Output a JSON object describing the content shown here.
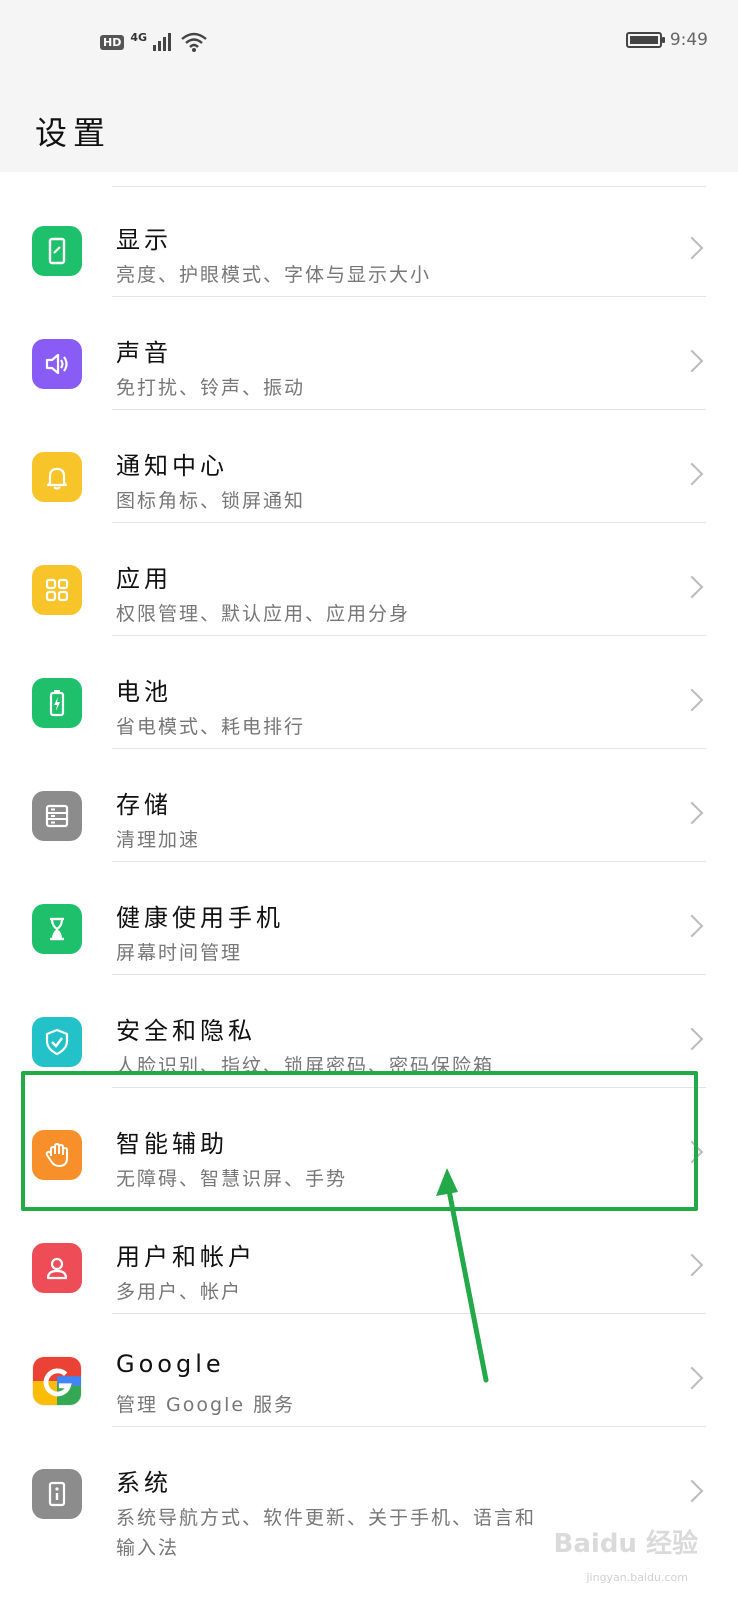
{
  "status_bar": {
    "hd": "HD",
    "network": "4G",
    "time": "9:49"
  },
  "header": {
    "title": "设置"
  },
  "items": [
    {
      "title": "显示",
      "subtitle": "亮度、护眼模式、字体与显示大小",
      "icon": "phone-display-icon",
      "color": "#1ec06b"
    },
    {
      "title": "声音",
      "subtitle": "免打扰、铃声、振动",
      "icon": "speaker-icon",
      "color": "#8a5cf6"
    },
    {
      "title": "通知中心",
      "subtitle": "图标角标、锁屏通知",
      "icon": "bell-icon",
      "color": "#f7c42a"
    },
    {
      "title": "应用",
      "subtitle": "权限管理、默认应用、应用分身",
      "icon": "apps-grid-icon",
      "color": "#f7c42a"
    },
    {
      "title": "电池",
      "subtitle": "省电模式、耗电排行",
      "icon": "battery-icon",
      "color": "#1ec06b"
    },
    {
      "title": "存储",
      "subtitle": "清理加速",
      "icon": "storage-icon",
      "color": "#8c8c8c"
    },
    {
      "title": "健康使用手机",
      "subtitle": "屏幕时间管理",
      "icon": "hourglass-icon",
      "color": "#1ec06b"
    },
    {
      "title": "安全和隐私",
      "subtitle": "人脸识别、指纹、锁屏密码、密码保险箱",
      "icon": "shield-check-icon",
      "color": "#22c2c8"
    },
    {
      "title": "智能辅助",
      "subtitle": "无障碍、智慧识屏、手势",
      "icon": "hand-icon",
      "color": "#f78f2a"
    },
    {
      "title": "用户和帐户",
      "subtitle": "多用户、帐户",
      "icon": "user-icon",
      "color": "#ee4d57"
    },
    {
      "title": "Google",
      "subtitle": "管理 Google 服务",
      "icon": "google-icon",
      "color": "#ffffff"
    },
    {
      "title": "系统",
      "subtitle": "系统导航方式、软件更新、关于手机、语言和",
      "subtitle2": "输入法",
      "icon": "info-icon",
      "color": "#8c8c8c"
    }
  ],
  "watermark": {
    "text": "Baidu 经验",
    "sub": "jingyan.baidu.com"
  }
}
